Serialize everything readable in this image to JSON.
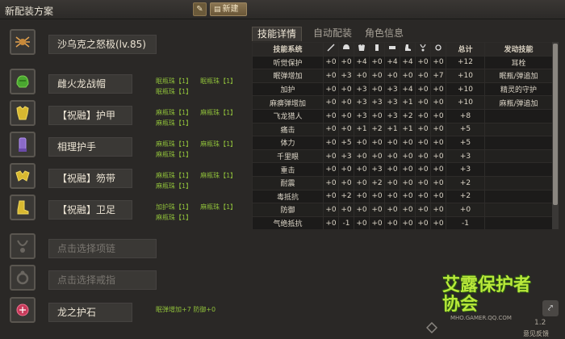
{
  "header": {
    "title": "新配装方案",
    "new_label": "新建"
  },
  "equipment": [
    {
      "name": "沙乌克之怒极(lv.85)",
      "slots": [],
      "icon": "spider-weapon-icon"
    },
    {
      "name": "雌火龙战帽",
      "slots": [
        "眠瓶珠【1】",
        "眠瓶珠【1】",
        "眠瓶珠【1】"
      ],
      "icon": "helmet-icon"
    },
    {
      "name": "【祝融】护甲",
      "slots": [
        "麻瓶珠【1】",
        "麻瓶珠【1】",
        "麻瓶珠【1】"
      ],
      "icon": "armor-icon"
    },
    {
      "name": "相理护手",
      "slots": [
        "麻瓶珠【1】",
        "麻瓶珠【1】",
        "麻瓶珠【1】"
      ],
      "icon": "gauntlet-icon"
    },
    {
      "name": "【祝融】笏带",
      "slots": [
        "麻瓶珠【1】",
        "麻瓶珠【1】",
        "麻瓶珠【1】"
      ],
      "icon": "belt-icon"
    },
    {
      "name": "【祝融】卫足",
      "slots": [
        "加护珠【1】",
        "麻瓶珠【1】",
        "麻瓶珠【1】"
      ],
      "icon": "boots-icon"
    },
    {
      "name": "点击选择项链",
      "slots": [],
      "icon": "necklace-icon",
      "empty": true
    },
    {
      "name": "点击选择戒指",
      "slots": [],
      "icon": "ring-icon",
      "empty": true
    },
    {
      "name": "龙之护石",
      "slots": [
        "眠弹增加+7 防御+0"
      ],
      "icon": "talisman-icon"
    }
  ],
  "tabs": [
    {
      "label": "技能详情",
      "active": true
    },
    {
      "label": "自动配装",
      "active": false
    },
    {
      "label": "角色信息",
      "active": false
    }
  ],
  "skills_table": {
    "headers": [
      "技能系统",
      "weapon-icon",
      "helmet-icon",
      "armor-icon",
      "gauntlet-icon",
      "belt-icon",
      "boots-icon",
      "necklace-icon",
      "ring-icon",
      "总计",
      "发动技能"
    ],
    "rows": [
      [
        "听觉保护",
        "+0",
        "+0",
        "+4",
        "+0",
        "+4",
        "+4",
        "+0",
        "+0",
        "+12",
        "耳栓"
      ],
      [
        "眠弹增加",
        "+0",
        "+3",
        "+0",
        "+0",
        "+0",
        "+0",
        "+0",
        "+7",
        "+10",
        "眠瓶/弹追加"
      ],
      [
        "加护",
        "+0",
        "+0",
        "+3",
        "+0",
        "+3",
        "+4",
        "+0",
        "+0",
        "+10",
        "精灵的守护"
      ],
      [
        "麻痹弹增加",
        "+0",
        "+0",
        "+3",
        "+3",
        "+3",
        "+1",
        "+0",
        "+0",
        "+10",
        "麻瓶/弹追加"
      ],
      [
        "飞龙猎人",
        "+0",
        "+0",
        "+3",
        "+0",
        "+3",
        "+2",
        "+0",
        "+0",
        "+8",
        ""
      ],
      [
        "痛击",
        "+0",
        "+0",
        "+1",
        "+2",
        "+1",
        "+1",
        "+0",
        "+0",
        "+5",
        ""
      ],
      [
        "体力",
        "+0",
        "+5",
        "+0",
        "+0",
        "+0",
        "+0",
        "+0",
        "+0",
        "+5",
        ""
      ],
      [
        "千里眼",
        "+0",
        "+3",
        "+0",
        "+0",
        "+0",
        "+0",
        "+0",
        "+0",
        "+3",
        ""
      ],
      [
        "重击",
        "+0",
        "+0",
        "+0",
        "+3",
        "+0",
        "+0",
        "+0",
        "+0",
        "+3",
        ""
      ],
      [
        "耐震",
        "+0",
        "+0",
        "+0",
        "+2",
        "+0",
        "+0",
        "+0",
        "+0",
        "+2",
        ""
      ],
      [
        "毒抵抗",
        "+0",
        "+2",
        "+0",
        "+0",
        "+0",
        "+0",
        "+0",
        "+0",
        "+2",
        ""
      ],
      [
        "防御",
        "+0",
        "+0",
        "+0",
        "+0",
        "+0",
        "+0",
        "+0",
        "+0",
        "+0",
        ""
      ],
      [
        "气绝抵抗",
        "+0",
        "-1",
        "+0",
        "+0",
        "+0",
        "+0",
        "+0",
        "+0",
        "-1",
        ""
      ]
    ]
  },
  "logo": {
    "title": "艾露保护者协会",
    "url": "MHO.GAMER.QQ.COM"
  },
  "footer": {
    "version": "1.2",
    "feedback": "意见反馈"
  },
  "colors": {
    "slot_text": "#8fbf3a",
    "accent": "#8a7552",
    "logo_green": "#b8e83a"
  }
}
